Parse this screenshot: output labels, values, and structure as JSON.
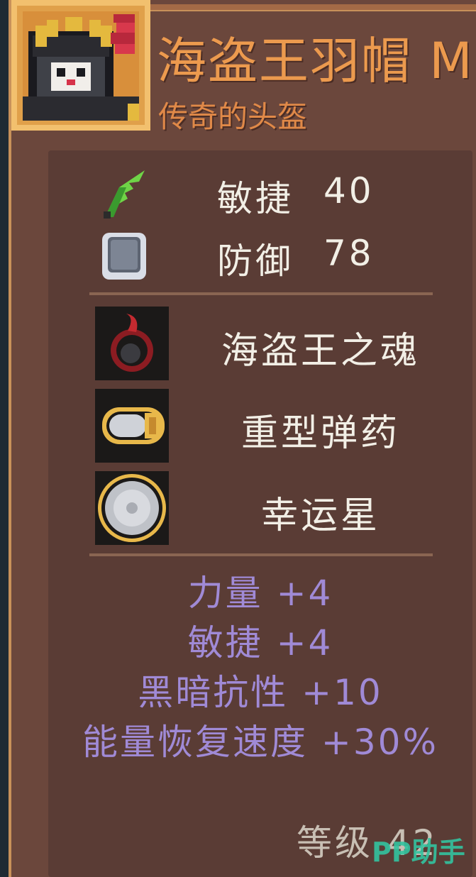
{
  "item": {
    "name": "海盗王羽帽 M",
    "rarity_text": "传奇的头盔",
    "portrait_icon": "pirate-king-hat-icon"
  },
  "base_stats": [
    {
      "icon": "agility-leaf-icon",
      "label": "敏捷",
      "value": "40"
    },
    {
      "icon": "defense-shield-icon",
      "label": "防御",
      "value": "78"
    }
  ],
  "skills": [
    {
      "icon": "pirate-soul-icon",
      "name": "海盗王之魂"
    },
    {
      "icon": "heavy-ammo-icon",
      "name": "重型弹药"
    },
    {
      "icon": "lucky-star-icon",
      "name": "幸运星"
    }
  ],
  "bonuses": [
    "力量 +4",
    "敏捷 +4",
    "黑暗抗性 +10",
    "能量恢复速度 +30%"
  ],
  "level_text": "等级 42",
  "watermark": "PP助手",
  "colors": {
    "title": "#ec9a4e",
    "bonus": "#a08ad6",
    "panel": "#5a3c35",
    "card": "#6b473c",
    "watermark": "#33c4a0"
  }
}
